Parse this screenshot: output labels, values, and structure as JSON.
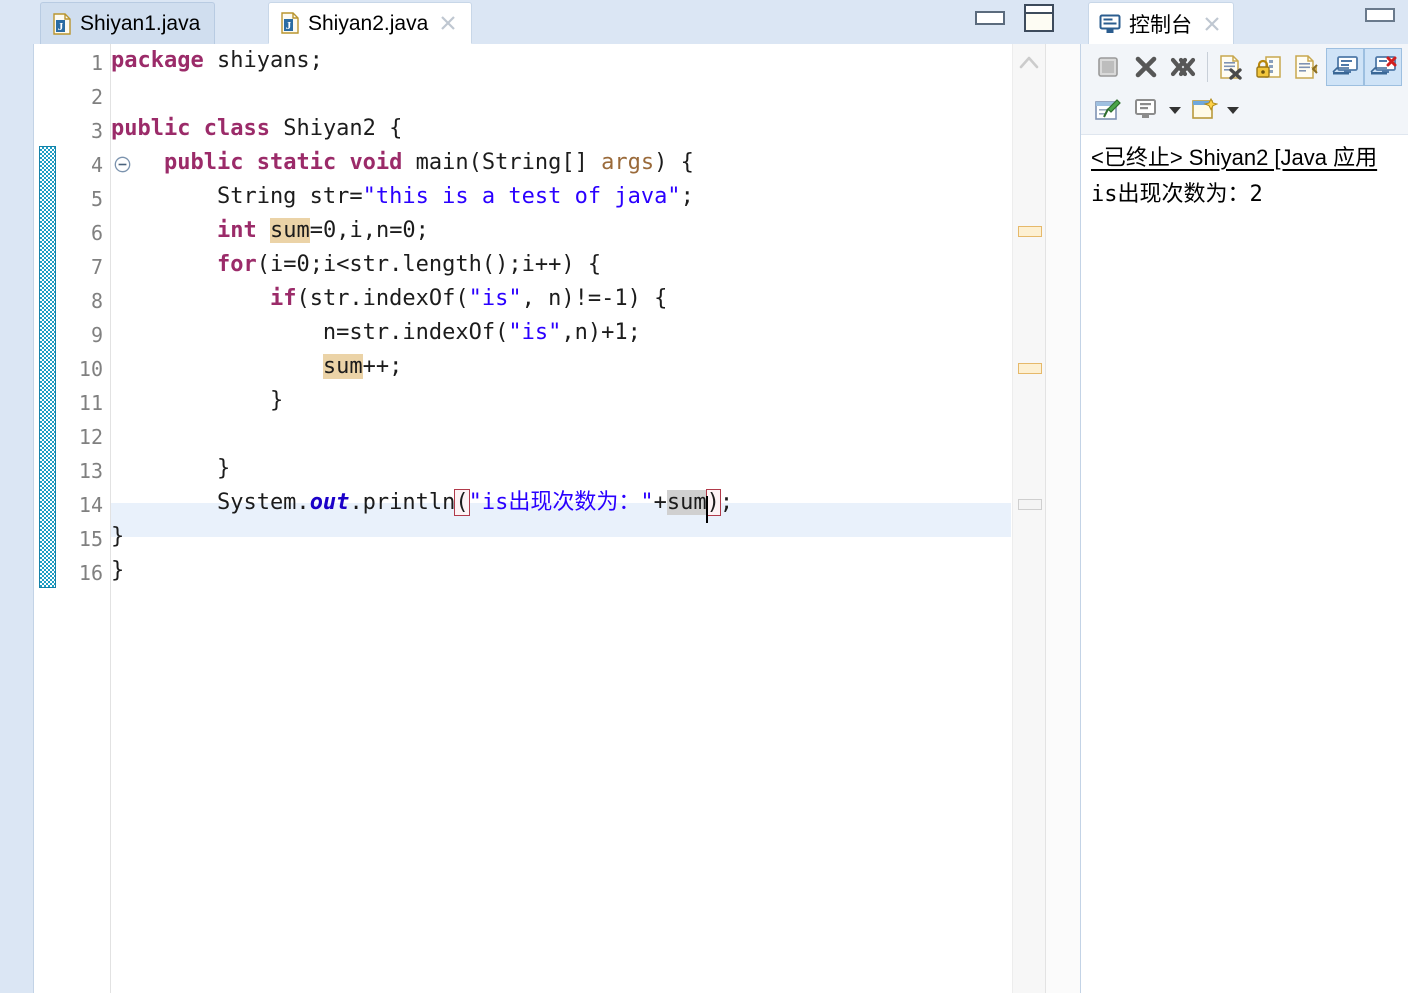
{
  "editor": {
    "tabs": [
      {
        "label": "Shiyan1.java",
        "icon": "java-file-icon",
        "active": false,
        "closable": false
      },
      {
        "label": "Shiyan2.java",
        "icon": "java-file-icon",
        "active": true,
        "closable": true
      }
    ],
    "window_buttons": {
      "minimize": "minimize-editor",
      "maximize": "maximize-editor"
    },
    "line_numbers": [
      "1",
      "2",
      "3",
      "4",
      "5",
      "6",
      "7",
      "8",
      "9",
      "10",
      "11",
      "12",
      "13",
      "14",
      "15",
      "16"
    ],
    "fold_marker_line": "4",
    "current_line": "14",
    "code_lines": [
      {
        "n": "1",
        "text": "package shiyans;"
      },
      {
        "n": "2",
        "text": ""
      },
      {
        "n": "3",
        "text": "public class Shiyan2 {"
      },
      {
        "n": "4",
        "text": "    public static void main(String[] args) {"
      },
      {
        "n": "5",
        "text": "        String str=\"this is a test of java\";"
      },
      {
        "n": "6",
        "text": "        int sum=0,i,n=0;"
      },
      {
        "n": "7",
        "text": "        for(i=0;i<str.length();i++) {"
      },
      {
        "n": "8",
        "text": "            if(str.indexOf(\"is\", n)!=-1) {"
      },
      {
        "n": "9",
        "text": "                n=str.indexOf(\"is\",n)+1;"
      },
      {
        "n": "10",
        "text": "                sum++;"
      },
      {
        "n": "11",
        "text": "            }"
      },
      {
        "n": "12",
        "text": ""
      },
      {
        "n": "13",
        "text": "        }"
      },
      {
        "n": "14",
        "text": "        System.out.println(\"is出现次数为：\"+sum);"
      },
      {
        "n": "15",
        "text": "}"
      },
      {
        "n": "16",
        "text": "}"
      }
    ],
    "tokens": {
      "kw_package": "package",
      "ident_shiyans": " shiyans;",
      "kw_public": "public",
      "kw_class": " class ",
      "ident_Shiyan2": "Shiyan2 {",
      "l4_indent": "    ",
      "l4_public": "public",
      "l4_static": " static ",
      "l4_void": "void",
      "l4_main": " main(String[] ",
      "l4_args": "args",
      "l4_tail": ") {",
      "l5_indent": "        String str=",
      "l5_string": "\"this is a test of java\"",
      "l5_tail": ";",
      "l6_indent": "        ",
      "l6_int": "int",
      "l6_space": " ",
      "l6_sum": "sum",
      "l6_tail": "=0,i,n=0;",
      "l7_indent": "        ",
      "l7_for": "for",
      "l7_tail": "(i=0;i<str.length();i++) {",
      "l8_indent": "            ",
      "l8_if": "if",
      "l8_a": "(str.indexOf(",
      "l8_string": "\"is\"",
      "l8_tail": ", n)!=-1) {",
      "l9_indent": "                n=str.indexOf(",
      "l9_string": "\"is\"",
      "l9_tail": ",n)+1;",
      "l10_indent": "                ",
      "l10_sum": "sum",
      "l10_tail": "++;",
      "l11_text": "            }",
      "l13_text": "        }",
      "l14_indent": "        System.",
      "l14_out": "out",
      "l14_println": ".println",
      "l14_openparen": "(",
      "l14_string": "\"is出现次数为：\"",
      "l14_plus": "+",
      "l14_sum": "sum",
      "l14_closeparen": ")",
      "l14_semi": ";",
      "l15_text": "}",
      "l16_text": "}"
    },
    "overview_marks": [
      {
        "type": "occurrence",
        "top": "227"
      },
      {
        "type": "occurrence",
        "top": "364"
      },
      {
        "type": "gray",
        "top": "500"
      }
    ]
  },
  "console": {
    "title": "控制台",
    "title_icon": "console-icon",
    "closable": true,
    "window_buttons": {
      "minimize": "minimize-console",
      "maximize": "maximize-console"
    },
    "toolbar_row1": [
      {
        "name": "terminate-button",
        "icon": "stop-square-icon",
        "selected": false
      },
      {
        "name": "remove-launch-button",
        "icon": "x-icon",
        "selected": false
      },
      {
        "name": "remove-all-terminated-button",
        "icon": "double-x-icon",
        "selected": false
      },
      {
        "name": "clear-console-button",
        "icon": "clear-console-icon",
        "selected": false
      },
      {
        "name": "scroll-lock-button",
        "icon": "lock-icon",
        "selected": false
      },
      {
        "name": "word-wrap-button",
        "icon": "word-wrap-icon",
        "selected": false
      },
      {
        "name": "show-console-on-output-button",
        "icon": "console-display-icon",
        "selected": true
      },
      {
        "name": "show-console-on-error-button",
        "icon": "console-error-icon",
        "selected": true
      }
    ],
    "toolbar_row2": [
      {
        "name": "pin-console-button",
        "icon": "pin-icon"
      },
      {
        "name": "display-selected-console-button",
        "icon": "monitor-icon",
        "has_dropdown": true
      },
      {
        "name": "open-console-button",
        "icon": "new-console-icon",
        "has_dropdown": true
      }
    ],
    "launch_label": "<已终止> Shiyan2 [Java 应用",
    "output_text": "is出现次数为：2"
  },
  "colors": {
    "keyword": "#9b2b69",
    "string": "#2a00ff",
    "parameter": "#9a6a3a",
    "field": "#1a00c8",
    "occurrence_highlight": "#ebd3a7",
    "selection": "#d0d0d0",
    "current_line": "#e9f1fb",
    "change_bar": "#1e9ec4",
    "chrome": "#dbe6f4",
    "toolbar_selected": "#cfe3f7"
  }
}
